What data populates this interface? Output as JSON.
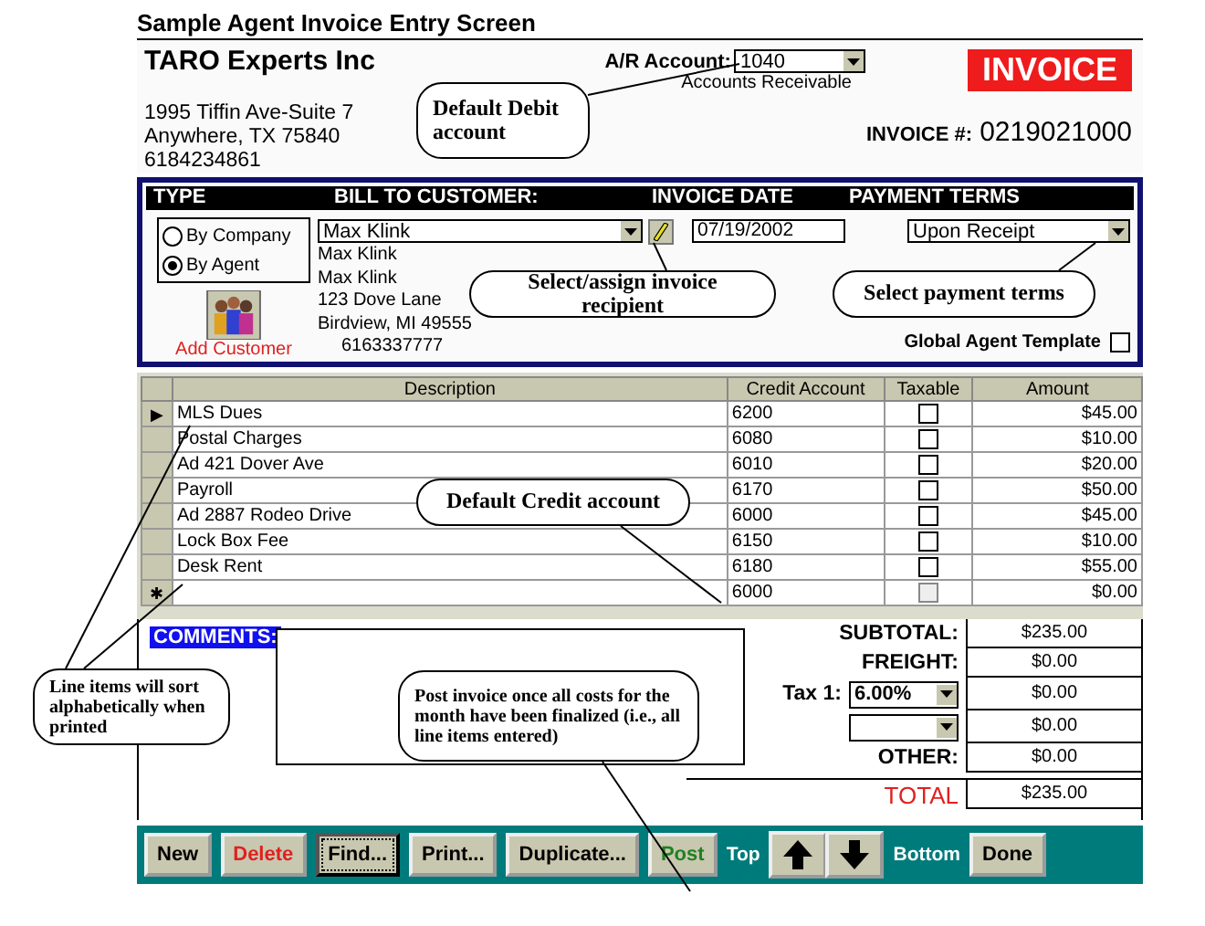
{
  "page_title": "Sample Agent Invoice Entry Screen",
  "company": {
    "name": "TARO Experts Inc",
    "address": [
      "1995 Tiffin Ave-Suite 7",
      "Anywhere, TX 75840",
      "6184234861"
    ]
  },
  "ar_account": {
    "label": "A/R Account:",
    "value": "1040",
    "description": "Accounts Receivable"
  },
  "invoice_badge": "INVOICE",
  "invoice_number": {
    "label": "INVOICE #:",
    "value": "0219021000"
  },
  "header_columns": [
    "TYPE",
    "BILL TO CUSTOMER:",
    "INVOICE DATE",
    "PAYMENT TERMS"
  ],
  "type_options": [
    {
      "label": "By Company",
      "selected": false
    },
    {
      "label": "By Agent",
      "selected": true
    }
  ],
  "add_customer": "Add Customer",
  "customer": {
    "value": "Max Klink",
    "details": [
      "Max Klink",
      "Max Klink",
      "123 Dove Lane",
      "Birdview, MI 49555",
      "6163337777"
    ]
  },
  "invoice_date": "07/19/2002",
  "payment_terms": "Upon Receipt",
  "global_agent_template": {
    "label": "Global Agent Template",
    "checked": false
  },
  "table": {
    "columns": [
      "Description",
      "Credit Account",
      "Taxable",
      "Amount"
    ],
    "rows": [
      {
        "marker": "▶",
        "description": "MLS Dues",
        "account": "6200",
        "taxable": false,
        "kind": "item",
        "amount": "$45.00"
      },
      {
        "description": "Postal Charges",
        "account": "6080",
        "taxable": false,
        "kind": "item",
        "amount": "$10.00"
      },
      {
        "description": "Ad 421 Dover Ave",
        "account": "6010",
        "taxable": false,
        "kind": "item",
        "amount": "$20.00"
      },
      {
        "description": "Payroll",
        "account": "6170",
        "taxable": false,
        "kind": "item",
        "amount": "$50.00"
      },
      {
        "description": "Ad 2887 Rodeo Drive",
        "account": "6000",
        "taxable": false,
        "kind": "item",
        "amount": "$45.00"
      },
      {
        "description": "Lock Box Fee",
        "account": "6150",
        "taxable": false,
        "kind": "item",
        "amount": "$10.00"
      },
      {
        "description": "Desk Rent",
        "account": "6180",
        "taxable": false,
        "kind": "item",
        "amount": "$55.00"
      },
      {
        "marker": "✱",
        "description": "",
        "account": "6000",
        "taxable": false,
        "kind": "new",
        "amount": "$0.00"
      }
    ]
  },
  "comments_label": "COMMENTS:",
  "totals": [
    {
      "kind": "label",
      "label": "SUBTOTAL:",
      "amount": "$235.00"
    },
    {
      "kind": "label",
      "label": "FREIGHT:",
      "amount": "$0.00"
    },
    {
      "kind": "tax",
      "label": "Tax 1:",
      "value": "6.00%",
      "amount": "$0.00"
    },
    {
      "kind": "tax",
      "amount": "$0.00"
    },
    {
      "kind": "label",
      "label": "OTHER:",
      "amount": "$0.00"
    },
    {
      "kind": "total",
      "label": "TOTAL",
      "amount": "$235.00"
    }
  ],
  "toolbar": [
    {
      "kind": "button",
      "label": "New",
      "color": "#000000",
      "focused": false
    },
    {
      "kind": "button",
      "label": "Delete",
      "color": "#e02020",
      "focused": false
    },
    {
      "kind": "button",
      "label": "Find...",
      "color": "#000000",
      "focused": true
    },
    {
      "kind": "button",
      "label": "Print...",
      "color": "#000000",
      "focused": false
    },
    {
      "kind": "button",
      "label": "Duplicate...",
      "color": "#000000",
      "focused": false
    },
    {
      "kind": "button",
      "label": "Post",
      "color": "#208020",
      "focused": false
    },
    {
      "kind": "label",
      "label": "Top"
    },
    {
      "kind": "up"
    },
    {
      "kind": "down"
    },
    {
      "kind": "label",
      "label": "Bottom"
    },
    {
      "kind": "button",
      "label": "Done",
      "color": "#000000",
      "focused": false
    }
  ],
  "callouts": [
    "Default Debit account",
    "Select/assign invoice recipient",
    "Select payment terms",
    "Default Credit account",
    "Line items will sort alphabetically when printed",
    "Post invoice once all costs for the month have been finalized (i.e., all line items entered)"
  ]
}
